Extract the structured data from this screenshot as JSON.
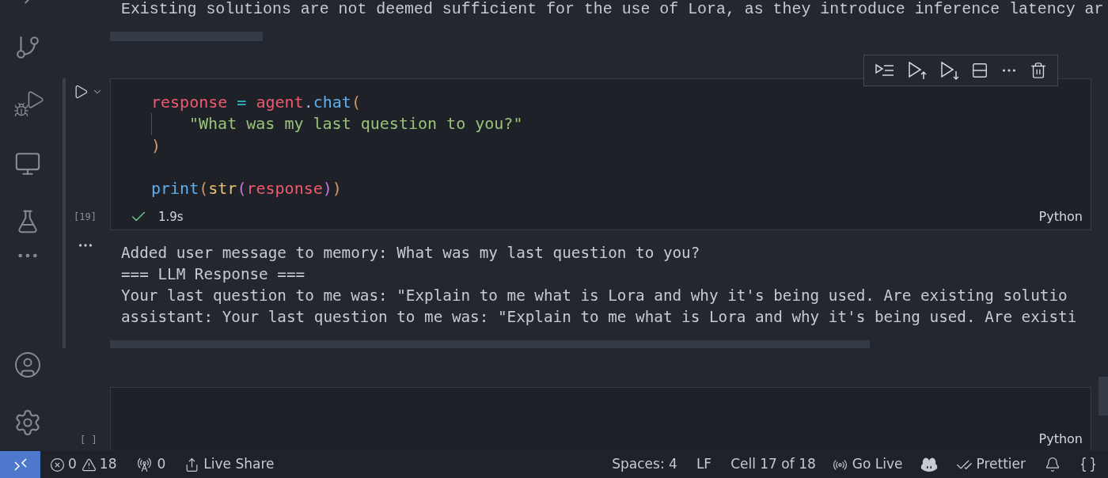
{
  "markdown_cell": {
    "text": "Existing solutions are not deemed sufficient for the use of Lora, as they introduce inference latency ar"
  },
  "code_cell": {
    "execution_count": "[19]",
    "lines": [
      {
        "indent_guide": false,
        "tokens": [
          {
            "kind": "variable",
            "text": "response"
          },
          {
            "kind": "operator",
            "text": " = "
          },
          {
            "kind": "variable",
            "text": "agent"
          },
          {
            "kind": "punct",
            "text": "."
          },
          {
            "kind": "function",
            "text": "chat"
          },
          {
            "kind": "bracket",
            "text": "("
          }
        ]
      },
      {
        "indent_guide": true,
        "tokens": [
          {
            "kind": "string",
            "text": "\"What was my last question to you?\""
          }
        ]
      },
      {
        "indent_guide": false,
        "tokens": [
          {
            "kind": "bracket",
            "text": ")"
          }
        ]
      },
      {
        "indent_guide": false
      },
      {
        "indent_guide": false,
        "tokens": [
          {
            "kind": "function",
            "text": "print"
          },
          {
            "kind": "bracket",
            "text": "("
          },
          {
            "kind": "builtin",
            "text": "str"
          },
          {
            "kind": "bracket2",
            "text": "("
          },
          {
            "kind": "variable",
            "text": "response"
          },
          {
            "kind": "bracket2",
            "text": ")"
          },
          {
            "kind": "bracket",
            "text": ")"
          }
        ]
      }
    ],
    "duration": "1.9s",
    "language": "Python"
  },
  "output": {
    "lines": [
      "Added user message to memory: What was my last question to you?",
      "=== LLM Response ===",
      "Your last question to me was: \"Explain to me what is Lora and why it's being used. Are existing solutio",
      "assistant: Your last question to me was: \"Explain to me what is Lora and why it's being used. Are existi"
    ]
  },
  "empty_cell": {
    "execution_count": "[ ]",
    "language": "Python"
  },
  "status_bar": {
    "errors": "0",
    "warnings": "18",
    "ports": "0",
    "live_share": "Live Share",
    "spaces": "Spaces: 4",
    "eol": "LF",
    "cell": "Cell 17 of 18",
    "go_live": "Go Live",
    "formatter": "Prettier"
  }
}
